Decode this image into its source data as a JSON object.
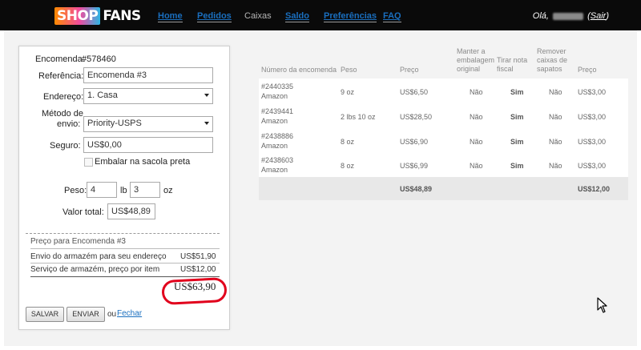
{
  "navbar": {
    "logo_part1": "SHOP",
    "logo_part2": "FANS",
    "items": [
      "Home",
      "Pedidos",
      "Caixas",
      "Saldo",
      "Preferências",
      "FAQ"
    ],
    "greeting_prefix": "Olá,",
    "logout_label": "Sair"
  },
  "form": {
    "encomenda_label": "Encomenda:",
    "encomenda_value": "#578460",
    "referencia_label": "Referência:",
    "referencia_value": "Encomenda #3",
    "endereco_label": "Endereço:",
    "endereco_value": "1. Casa",
    "metodo_label_1": "Método de",
    "metodo_label_2": "envio:",
    "metodo_value": "Priority-USPS",
    "seguro_label": "Seguro:",
    "seguro_value": "US$0,00",
    "embalar_label": "Embalar na sacola preta",
    "peso_label": "Peso:",
    "peso_lb": "4",
    "lb_unit": "lb",
    "peso_oz": "3",
    "oz_unit": "oz",
    "valor_total_label": "Valor total:",
    "valor_total_value": "US$48,89"
  },
  "price_box": {
    "title": "Preço para Encomenda #3",
    "lines": [
      {
        "label": "Envio do armazém para seu endereço",
        "value": "US$51,90"
      },
      {
        "label": "Serviço de armazém, preço por item",
        "value": "US$12,00"
      }
    ],
    "total": "US$63,90"
  },
  "buttons": {
    "save": "SALVAR",
    "send": "ENVIAR",
    "or": "ou",
    "close": "Fechar"
  },
  "table": {
    "headers": [
      "Número da encomenda",
      "Peso",
      "Preço",
      "Manter a embalagem original",
      "Tirar nota fiscal",
      "Remover caixas de sapatos",
      "Preço"
    ],
    "rows": [
      {
        "id": "#2440335",
        "store": "Amazon",
        "weight": "9 oz",
        "price": "US$6,50",
        "keep": "Não",
        "invoice": "Sim",
        "remove": "Não",
        "fee": "US$3,00"
      },
      {
        "id": "#2439441",
        "store": "Amazon",
        "weight": "2 lbs 10 oz",
        "price": "US$28,50",
        "keep": "Não",
        "invoice": "Sim",
        "remove": "Não",
        "fee": "US$3,00"
      },
      {
        "id": "#2438886",
        "store": "Amazon",
        "weight": "8 oz",
        "price": "US$6,90",
        "keep": "Não",
        "invoice": "Sim",
        "remove": "Não",
        "fee": "US$3,00"
      },
      {
        "id": "#2438603",
        "store": "Amazon",
        "weight": "8 oz",
        "price": "US$6,99",
        "keep": "Não",
        "invoice": "Sim",
        "remove": "Não",
        "fee": "US$3,00"
      }
    ],
    "footer_price": "US$48,89",
    "footer_fee": "US$12,00"
  },
  "colors": {
    "navbar_bg": "#0a0a0a",
    "link": "#1a6fbf",
    "highlight_circle": "#e1001c"
  }
}
